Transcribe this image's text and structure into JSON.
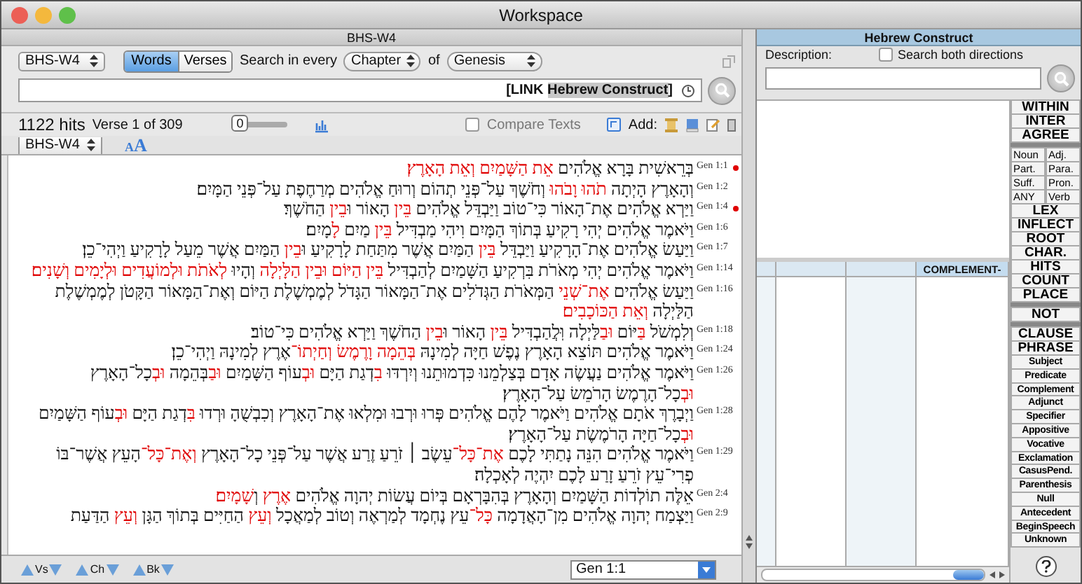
{
  "window": {
    "title": "Workspace"
  },
  "module_title": "BHS-W4",
  "toolbar": {
    "version_select": "BHS-W4",
    "words_mode": {
      "label": "Words",
      "selected": true
    },
    "verses_mode": {
      "label": "Verses",
      "selected": false
    },
    "search_in_label": "Search in every",
    "range_select": "Chapter",
    "of_label": "of",
    "book_select": "Genesis"
  },
  "search": {
    "query_prefix": {
      "text": "[LINK ",
      "highlighted": false
    },
    "query_name": {
      "text": "Hebrew Construct",
      "highlighted": true
    },
    "query_suffix": {
      "text": "]",
      "highlighted": false
    }
  },
  "results": {
    "hits": "1122 hits",
    "position": "Verse 1 of 309",
    "slider": {
      "level": 0,
      "value_label": "0"
    },
    "compare_texts": {
      "label": "Compare Texts",
      "checked": false
    },
    "add_label": "Add:"
  },
  "text_pane": {
    "version_select": "BHS-W4",
    "smaller_text_button": "A",
    "larger_text_button": "A",
    "verses": [
      {
        "ref": "Gen 1:1",
        "marked": true,
        "segments": [
          {
            "text": "בְּרֵאשִׁית בָּרָא אֱלֹהִים ",
            "hit": false
          },
          {
            "text": "אֵת הַשָּׁמַיִם וְאֵת הָאָרֶץ׃",
            "hit": true
          }
        ]
      },
      {
        "ref": "Gen 1:2",
        "marked": false,
        "segments": [
          {
            "text": "וְהָאָרֶץ הָיְתָה ",
            "hit": false
          },
          {
            "text": "תֹהוּ וָבֹהוּ",
            "hit": true
          },
          {
            "text": " וְחֹשֶׁךְ עַל־פְּנֵי תְהוֹם וְרוּחַ אֱלֹהִים מְרַחֶפֶת עַל־פְּנֵי הַמָּיִם׃",
            "hit": false
          }
        ]
      },
      {
        "ref": "Gen 1:4",
        "marked": true,
        "segments": [
          {
            "text": "וַיַּרְא אֱלֹהִים אֶת־הָאוֹר כִּי־טוֹב וַיַּבְדֵּל אֱלֹהִים ",
            "hit": false
          },
          {
            "text": "בֵּין",
            "hit": true
          },
          {
            "text": " הָאוֹר וּ",
            "hit": false
          },
          {
            "text": "בֵין",
            "hit": true
          },
          {
            "text": " הַחֹשֶׁךְ׃",
            "hit": false
          }
        ]
      },
      {
        "ref": "Gen 1:6",
        "marked": false,
        "segments": [
          {
            "text": "וַיֹּאמֶר אֱלֹהִים יְהִי רָקִיעַ בְּתוֹךְ הַמָּיִם וִיהִי מַבְדִּיל ",
            "hit": false
          },
          {
            "text": "בֵּין",
            "hit": true
          },
          {
            "text": " מַיִם ",
            "hit": false
          },
          {
            "text": "לָ",
            "hit": true
          },
          {
            "text": "מָיִם׃",
            "hit": false
          }
        ]
      },
      {
        "ref": "Gen 1:7",
        "marked": false,
        "segments": [
          {
            "text": "וַיַּעַשׂ אֱלֹהִים אֶת־הָרָקִיעַ וַיַּבְדֵּל ",
            "hit": false
          },
          {
            "text": "בֵּין",
            "hit": true
          },
          {
            "text": " הַמַּיִם אֲשֶׁר מִתַּחַת לָרָקִיעַ וּ",
            "hit": false
          },
          {
            "text": "בֵין",
            "hit": true
          },
          {
            "text": " הַמַּיִם אֲשֶׁר מֵעַל לָרָקִיעַ וַיְהִי־כֵן׃",
            "hit": false
          }
        ]
      },
      {
        "ref": "Gen 1:14",
        "marked": false,
        "segments": [
          {
            "text": "וַיֹּאמֶר אֱלֹהִים יְהִי מְאֹרֹת בִּרְקִיעַ הַשָּׁמַיִם לְהַבְדִּיל ",
            "hit": false
          },
          {
            "text": "בֵּין הַיּוֹם וּבֵין הַלָּיְלָה",
            "hit": true
          },
          {
            "text": " וְהָיוּ ",
            "hit": false
          },
          {
            "text": "לְאֹתֹת וּלְמוֹעֲדִים וּלְיָמִים וְשָׁנִים׃",
            "hit": true
          }
        ]
      },
      {
        "ref": "Gen 1:16",
        "marked": false,
        "segments": [
          {
            "text": "וַיַּעַשׂ אֱלֹהִים ",
            "hit": false
          },
          {
            "text": "אֶת־שְׁנֵי",
            "hit": true
          },
          {
            "text": " הַמְּאֹרֹת הַגְּדֹלִים אֶת־הַמָּאוֹר הַגָּדֹל לְמֶמְשֶׁלֶת הַיּוֹם וְאֶת־הַמָּאוֹר הַקָּטֹן לְמֶמְשֶׁלֶת הַלַּיְלָה ",
            "hit": false
          },
          {
            "text": "וְאֵת הַכּוֹכָבִים׃",
            "hit": true
          }
        ]
      },
      {
        "ref": "Gen 1:18",
        "marked": false,
        "segments": [
          {
            "text": "וְלִמְשֹׁל ",
            "hit": false
          },
          {
            "text": "בַּ",
            "hit": true
          },
          {
            "text": "יּוֹם ",
            "hit": false
          },
          {
            "text": "וּבַ",
            "hit": true
          },
          {
            "text": "לַּיְלָה וּֽלֲהַבְדִּיל ",
            "hit": false
          },
          {
            "text": "בֵּין",
            "hit": true
          },
          {
            "text": " הָאוֹר וּ",
            "hit": false
          },
          {
            "text": "בֵין",
            "hit": true
          },
          {
            "text": " הַחֹשֶׁךְ וַיַּרְא אֱלֹהִים כִּי־טוֹב׃",
            "hit": false
          }
        ]
      },
      {
        "ref": "Gen 1:24",
        "marked": false,
        "segments": [
          {
            "text": "וַיֹּאמֶר אֱלֹהִים תּוֹצֵא הָאָרֶץ נֶפֶשׁ חַיָּה לְמִינָהּ ",
            "hit": false
          },
          {
            "text": "בְּהֵמָה וָרֶמֶשׂ וְחַיְתוֹ־",
            "hit": true
          },
          {
            "text": "אֶרֶץ לְמִינָהּ וַיְהִי־כֵן׃",
            "hit": false
          }
        ]
      },
      {
        "ref": "Gen 1:26",
        "marked": false,
        "segments": [
          {
            "text": "וַיֹּאמֶר אֱלֹהִים נַעֲשֶׂה אָדָם בְּצַלְמֵנוּ כִּדְמוּתֵנוּ וְיִרְדּוּ ",
            "hit": false
          },
          {
            "text": "בִ",
            "hit": true
          },
          {
            "text": "דְגַת הַיָּם ",
            "hit": false
          },
          {
            "text": "וּבְ",
            "hit": true
          },
          {
            "text": "עוֹף הַשָּׁמַיִם ",
            "hit": false
          },
          {
            "text": "וּבַ",
            "hit": true
          },
          {
            "text": "בְּהֵמָה ",
            "hit": false
          },
          {
            "text": "וּבְ",
            "hit": true
          },
          {
            "text": "כָל־הָאָרֶץ ",
            "hit": false
          },
          {
            "text": "וּבְ",
            "hit": true
          },
          {
            "text": "כָל־הָרֶמֶשׂ הָרֹמֵשׂ עַל־הָאָרֶץ׃",
            "hit": false
          }
        ]
      },
      {
        "ref": "Gen 1:28",
        "marked": false,
        "segments": [
          {
            "text": "וַיְבָרֶךְ אֹתָם אֱלֹהִים וַיֹּאמֶר לָהֶם אֱלֹהִים פְּרוּ וּרְבוּ וּמִלְאוּ אֶת־הָאָרֶץ וְכִבְשֻׁהָ וּרְדוּ ",
            "hit": false
          },
          {
            "text": "בִּ",
            "hit": true
          },
          {
            "text": "דְגַת הַיָּם ",
            "hit": false
          },
          {
            "text": "וּבְ",
            "hit": true
          },
          {
            "text": "עוֹף הַשָּׁמַיִם ",
            "hit": false
          },
          {
            "text": "וּבְ",
            "hit": true
          },
          {
            "text": "כָל־חַיָּה הָרֹמֶשֶׂת עַל־הָאָרֶץ׃",
            "hit": false
          }
        ]
      },
      {
        "ref": "Gen 1:29",
        "marked": false,
        "segments": [
          {
            "text": "וַיֹּאמֶר אֱלֹהִים הִנֵּה נָתַתִּי לָכֶם ",
            "hit": false
          },
          {
            "text": "אֶת־כָּל־",
            "hit": true
          },
          {
            "text": "עֵשֶׂב ׀ זֹרֵעַ זֶרַע אֲשֶׁר עַל־פְּנֵי כָל־הָאָרֶץ ",
            "hit": false
          },
          {
            "text": "וְאֶת־כָּל־",
            "hit": true
          },
          {
            "text": "הָעֵץ אֲשֶׁר־בּוֹ פְרִי־עֵץ זֹרֵעַ זָרַע לָכֶם יִהְיֶה לְאָכְלָה׃",
            "hit": false
          }
        ]
      },
      {
        "ref": "Gen 2:4",
        "marked": false,
        "segments": [
          {
            "text": "אֵלֶּה תוֹלְדוֹת הַשָּׁמַיִם וְהָאָרֶץ בְּהִבָּרְאָם בְּיוֹם עֲשׂוֹת יְהוָה אֱלֹהִים ",
            "hit": false
          },
          {
            "text": "אֶרֶץ",
            "hit": true
          },
          {
            "text": " וְ",
            "hit": false
          },
          {
            "text": "שָׁמָיִם׃",
            "hit": true
          }
        ]
      },
      {
        "ref": "Gen 2:9",
        "marked": false,
        "segments": [
          {
            "text": "וַיַּצְמַח יְהוָה אֱלֹהִים מִן־הָאֲדָמָה ",
            "hit": false
          },
          {
            "text": "כָּל־",
            "hit": true
          },
          {
            "text": "עֵץ נֶחְמָד לְמַרְאֶה וְטוֹב לְמַאֲכָל ",
            "hit": false
          },
          {
            "text": "וְעֵץ",
            "hit": true
          },
          {
            "text": " הַחַיִּים בְּתוֹךְ הַגָּן ",
            "hit": false
          },
          {
            "text": "וְעֵץ",
            "hit": true
          },
          {
            "text": " הַדַּעַת",
            "hit": false
          }
        ]
      }
    ]
  },
  "navigation": {
    "verse_step": "Vs",
    "chapter_step": "Ch",
    "book_step": "Bk",
    "reference": "Gen 1:1"
  },
  "construct": {
    "title": "Hebrew Construct",
    "description_label": "Description:",
    "both_directions": {
      "label": "Search both directions",
      "checked": false
    },
    "column_header": "COMPLEMENT-",
    "buttons": [
      {
        "kind": "large",
        "labels": [
          "WITHIN"
        ]
      },
      {
        "kind": "large",
        "labels": [
          "INTER"
        ]
      },
      {
        "kind": "large",
        "labels": [
          "AGREE"
        ]
      },
      {
        "kind": "separator"
      },
      {
        "kind": "pair",
        "left_label": "Noun",
        "right_label": "Adj."
      },
      {
        "kind": "pair",
        "left_label": "Part.",
        "right_label": "Para."
      },
      {
        "kind": "pair",
        "left_label": "Suff.",
        "right_label": "Pron."
      },
      {
        "kind": "pair",
        "left_label": "ANY",
        "right_label": "Verb"
      },
      {
        "kind": "large",
        "labels": [
          "LEX"
        ]
      },
      {
        "kind": "large",
        "labels": [
          "INFLECT"
        ]
      },
      {
        "kind": "large",
        "labels": [
          "ROOT"
        ]
      },
      {
        "kind": "large",
        "labels": [
          "CHAR."
        ]
      },
      {
        "kind": "large",
        "labels": [
          "HITS"
        ]
      },
      {
        "kind": "large",
        "labels": [
          "COUNT"
        ]
      },
      {
        "kind": "large",
        "labels": [
          "PLACE"
        ]
      },
      {
        "kind": "separator"
      },
      {
        "kind": "large",
        "labels": [
          "NOT"
        ]
      },
      {
        "kind": "separator"
      },
      {
        "kind": "large",
        "labels": [
          "CLAUSE"
        ]
      },
      {
        "kind": "large",
        "labels": [
          "PHRASE"
        ]
      },
      {
        "kind": "small",
        "labels": [
          "Subject"
        ]
      },
      {
        "kind": "small",
        "labels": [
          "Predicate"
        ]
      },
      {
        "kind": "small",
        "labels": [
          "Complement"
        ]
      },
      {
        "kind": "small",
        "labels": [
          "Adjunct"
        ]
      },
      {
        "kind": "small",
        "labels": [
          "Specifier"
        ]
      },
      {
        "kind": "small",
        "labels": [
          "Appositive"
        ]
      },
      {
        "kind": "small",
        "labels": [
          "Vocative"
        ]
      },
      {
        "kind": "small",
        "labels": [
          "Exclamation"
        ]
      },
      {
        "kind": "small",
        "labels": [
          "CasusPend."
        ]
      },
      {
        "kind": "small",
        "labels": [
          "Parenthesis"
        ]
      },
      {
        "kind": "small",
        "labels": [
          "Null"
        ]
      },
      {
        "kind": "small",
        "labels": [
          "Antecedent"
        ]
      },
      {
        "kind": "small",
        "labels": [
          "BeginSpeech"
        ]
      },
      {
        "kind": "small",
        "labels": [
          "Unknown"
        ]
      }
    ]
  }
}
